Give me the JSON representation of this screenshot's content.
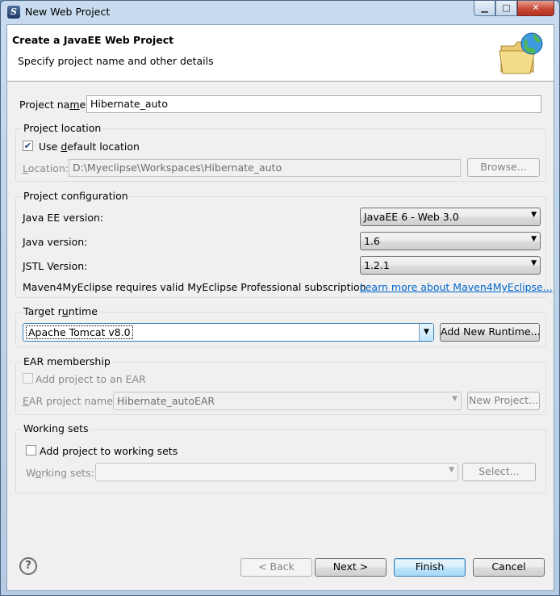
{
  "window": {
    "title": "New Web Project",
    "minimize": "▁",
    "maximize": "□",
    "close": "✕"
  },
  "header": {
    "title": "Create a JavaEE Web Project",
    "subtitle": "Specify project name and other details",
    "icon": "folder-globe-icon"
  },
  "project_name": {
    "label": "Project name:",
    "value": "Hibernate_auto"
  },
  "project_location": {
    "group": "Project location",
    "use_default_label": "Use default location",
    "use_default_checked": true,
    "location_label": "Location:",
    "location_value": "D:\\Myeclipse\\Workspaces\\Hibernate_auto",
    "browse": "Browse..."
  },
  "project_configuration": {
    "group": "Project configuration",
    "javaee_label": "Java EE version:",
    "javaee_value": "JavaEE 6 - Web 3.0",
    "java_label": "Java version:",
    "java_value": "1.6",
    "jstl_label": "JSTL Version:",
    "jstl_value": "1.2.1",
    "maven_note": "Maven4MyEclipse requires valid MyEclipse Professional subscription",
    "learn_more": "Learn more about Maven4MyEclipse..."
  },
  "target_runtime": {
    "group": "Target runtime",
    "value": "Apache Tomcat v8.0",
    "add_new": "Add New Runtime..."
  },
  "ear_membership": {
    "group": "EAR membership",
    "add_label": "Add project to an EAR",
    "ear_name_label": "EAR project name:",
    "ear_name_value": "Hibernate_autoEAR",
    "new_project": "New Project..."
  },
  "working_sets": {
    "group": "Working sets",
    "add_label": "Add project to working sets",
    "sets_label": "Working sets:",
    "sets_value": "",
    "select": "Select..."
  },
  "footer": {
    "help": "?",
    "back": "< Back",
    "next": "Next >",
    "finish": "Finish",
    "cancel": "Cancel"
  }
}
